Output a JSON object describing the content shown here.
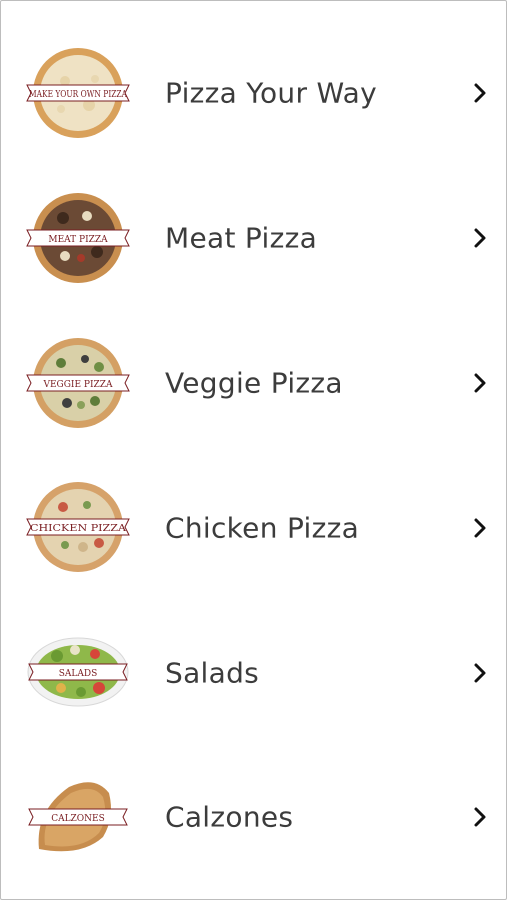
{
  "menu": {
    "items": [
      {
        "label": "Pizza Your Way",
        "ribbon": "MAKE YOUR OWN PIZZA",
        "icon": "pizza-your-way-thumbnail"
      },
      {
        "label": "Meat Pizza",
        "ribbon": "MEAT PIZZA",
        "icon": "meat-pizza-thumbnail"
      },
      {
        "label": "Veggie Pizza",
        "ribbon": "VEGGIE PIZZA",
        "icon": "veggie-pizza-thumbnail"
      },
      {
        "label": "Chicken Pizza",
        "ribbon": "CHICKEN PIZZA",
        "icon": "chicken-pizza-thumbnail"
      },
      {
        "label": "Salads",
        "ribbon": "SALADS",
        "icon": "salad-thumbnail"
      },
      {
        "label": "Calzones",
        "ribbon": "CALZONES",
        "icon": "calzone-thumbnail"
      }
    ],
    "chevron_icon": "chevron-right-icon"
  },
  "colors": {
    "text": "#3c3c3c",
    "ribbon_text": "#7a1e22",
    "chevron": "#111111",
    "border": "#bdbdbd"
  }
}
